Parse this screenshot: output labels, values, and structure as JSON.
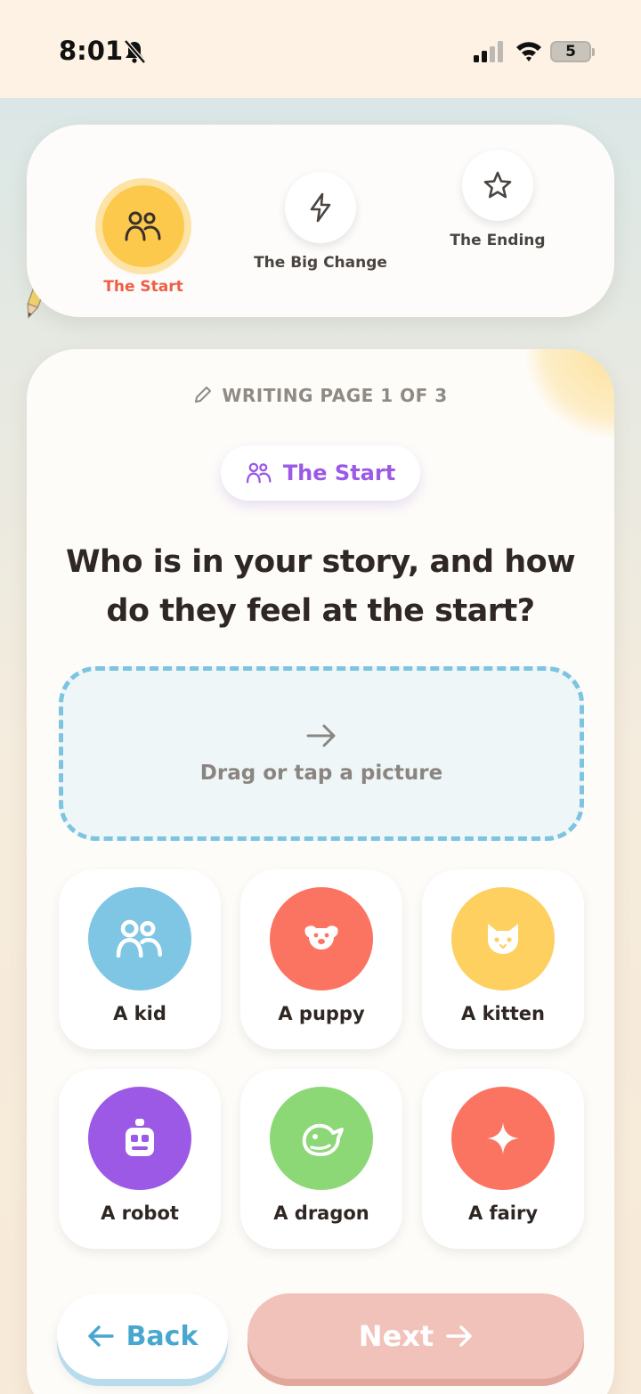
{
  "status_bar": {
    "time": "8:01",
    "battery": "5"
  },
  "steps": [
    {
      "label": "The Start",
      "icon": "people-icon",
      "active": true
    },
    {
      "label": "The Big Change",
      "icon": "lightning-icon",
      "active": false
    },
    {
      "label": "The Ending",
      "icon": "star-icon",
      "active": false
    }
  ],
  "main": {
    "page_counter": "WRITING PAGE 1 OF 3",
    "section_pill": "The Start",
    "question": "Who is in your story, and how do they feel at the start?",
    "dropzone_text": "Drag or tap a picture",
    "characters": [
      {
        "label": "A kid",
        "icon": "people-icon",
        "color": "#7fc6e4"
      },
      {
        "label": "A puppy",
        "icon": "dog-icon",
        "color": "#fb7462"
      },
      {
        "label": "A kitten",
        "icon": "cat-icon",
        "color": "#fdd060"
      },
      {
        "label": "A robot",
        "icon": "robot-icon",
        "color": "#9b59e6"
      },
      {
        "label": "A dragon",
        "icon": "dragon-icon",
        "color": "#8cd776"
      },
      {
        "label": "A fairy",
        "icon": "sparkle-icon",
        "color": "#fb7462"
      }
    ]
  },
  "nav": {
    "back_label": "Back",
    "next_label": "Next"
  }
}
